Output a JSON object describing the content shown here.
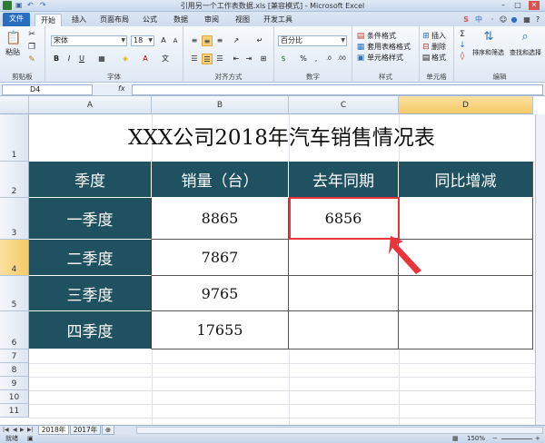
{
  "window": {
    "title": "引用另一个工作表数据.xls [兼容模式] - Microsoft Excel"
  },
  "ribbon": {
    "tabs": [
      "文件",
      "开始",
      "插入",
      "页面布局",
      "公式",
      "数据",
      "审阅",
      "视图",
      "开发工具"
    ],
    "active_tab": "开始",
    "clipboard": {
      "paste": "粘贴",
      "label": "剪贴板"
    },
    "font": {
      "family": "宋体",
      "size": "18",
      "label": "字体"
    },
    "alignment": {
      "label": "对齐方式"
    },
    "number": {
      "format": "百分比",
      "percent": "%",
      "comma": ",",
      "label": "数字"
    },
    "styles": {
      "conditional": "条件格式",
      "table": "套用表格格式",
      "cell_styles": "单元格样式",
      "label": "样式"
    },
    "cells": {
      "insert": "插入",
      "delete": "删除",
      "format": "格式",
      "label": "单元格"
    },
    "editing": {
      "sort_filter": "排序和筛选",
      "find_select": "查找和选择",
      "label": "编辑"
    },
    "ime": "中"
  },
  "formula_bar": {
    "name_box": "D4",
    "fx": "fx",
    "formula": ""
  },
  "grid": {
    "columns": [
      "A",
      "B",
      "C",
      "D"
    ],
    "rows": [
      "1",
      "2",
      "3",
      "4",
      "5",
      "6",
      "7",
      "8",
      "9",
      "10",
      "11"
    ],
    "title": "XXX公司2018年汽车销售情况表",
    "headers": [
      "季度",
      "销量（台）",
      "去年同期",
      "同比增减"
    ],
    "data": [
      {
        "quarter": "一季度",
        "sales": "8865",
        "last_year": "6856",
        "change": ""
      },
      {
        "quarter": "二季度",
        "sales": "7867",
        "last_year": "",
        "change": ""
      },
      {
        "quarter": "三季度",
        "sales": "9765",
        "last_year": "",
        "change": ""
      },
      {
        "quarter": "四季度",
        "sales": "17655",
        "last_year": "",
        "change": ""
      }
    ]
  },
  "sheet_tabs": [
    "2018年",
    "2017年"
  ],
  "status": {
    "mode": "就绪",
    "zoom": "150%"
  },
  "colors": {
    "header_fill": "#1f5161",
    "annotation": "#e8343a"
  }
}
